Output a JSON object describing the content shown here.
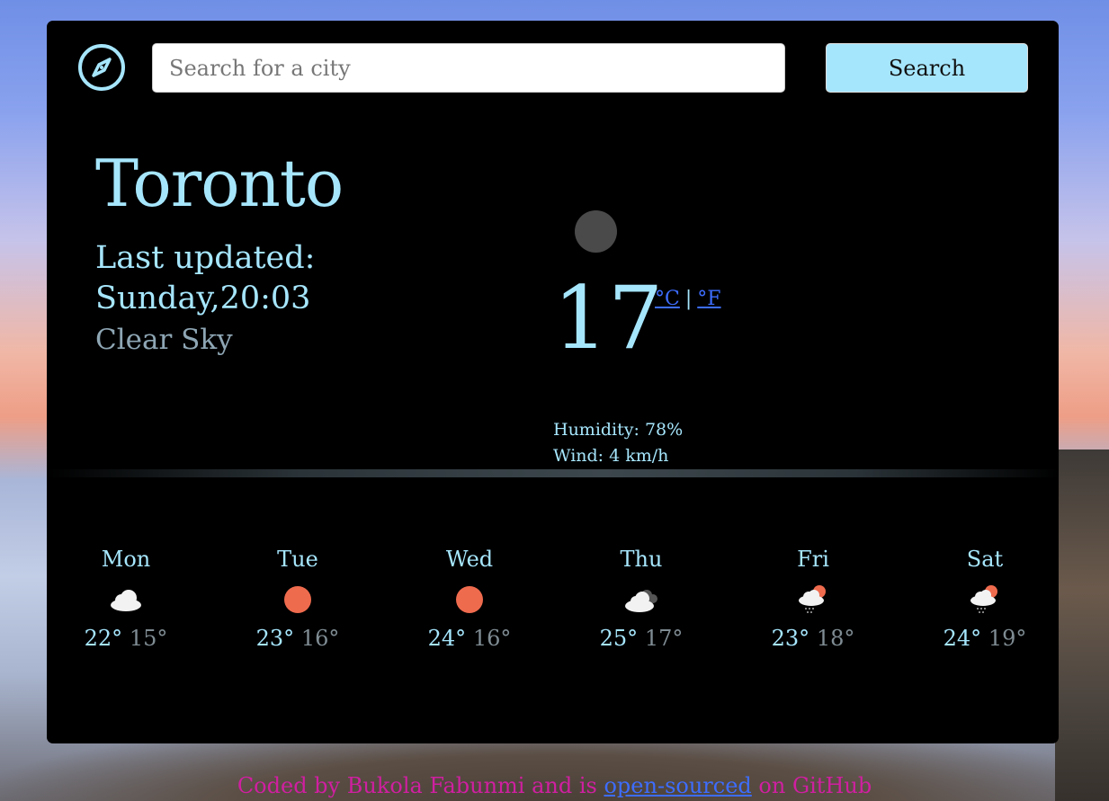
{
  "search": {
    "placeholder": "Search for a city",
    "button_label": "Search"
  },
  "current": {
    "city": "Toronto",
    "last_updated_label": "Last updated:",
    "last_updated_value": "Sunday,20:03",
    "description": "Clear Sky",
    "temperature": "17",
    "unit_c": "°C",
    "unit_separator": "|",
    "unit_f": "°F",
    "humidity": "Humidity: 78%",
    "wind": "Wind: 4 km/h"
  },
  "forecast": [
    {
      "day": "Mon",
      "icon": "cloud-icon",
      "max": "22°",
      "min": "15°"
    },
    {
      "day": "Tue",
      "icon": "sun-icon",
      "max": "23°",
      "min": "16°"
    },
    {
      "day": "Wed",
      "icon": "sun-icon",
      "max": "24°",
      "min": "16°"
    },
    {
      "day": "Thu",
      "icon": "dark-clouds-icon",
      "max": "25°",
      "min": "17°"
    },
    {
      "day": "Fri",
      "icon": "rain-sun-icon",
      "max": "23°",
      "min": "18°"
    },
    {
      "day": "Sat",
      "icon": "rain-sun-icon",
      "max": "24°",
      "min": "19°"
    }
  ],
  "footer": {
    "prefix": "Coded by Bukola Fabunmi and is ",
    "link": "open-sourced",
    "suffix": " on GitHub"
  },
  "colors": {
    "accent": "#a6e6fd",
    "card_background": "#000000",
    "link": "#3d6dff",
    "footer_text": "#d01fa1",
    "sun": "#ef6b4e"
  }
}
